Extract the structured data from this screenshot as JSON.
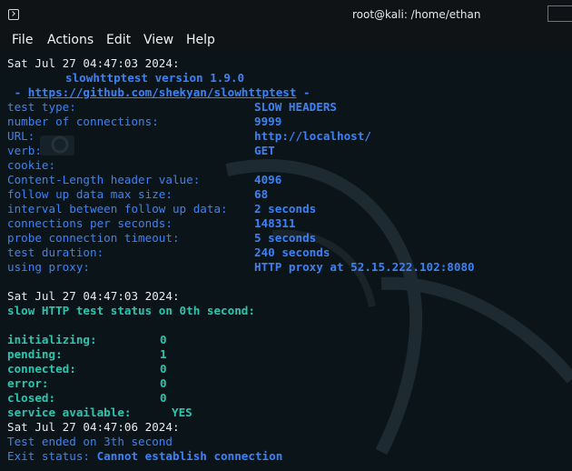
{
  "window": {
    "title": "root@kali: /home/ethan",
    "icon": "terminal-icon"
  },
  "menu": [
    "File",
    "Actions",
    "Edit",
    "View",
    "Help"
  ],
  "terminal": {
    "date1": "Sat Jul 27 04:47:03 2024:",
    "version": "slowhttptest version 1.9.0",
    "url_prefix": " - ",
    "url": "https://github.com/shekyan/slowhttptest",
    "url_suffix": " -",
    "params": [
      {
        "key": "test type:",
        "value": "SLOW HEADERS"
      },
      {
        "key": "number of connections:",
        "value": "9999"
      },
      {
        "key": "URL:",
        "value": "http://localhost/"
      },
      {
        "key": "verb:",
        "value": "GET"
      },
      {
        "key": "cookie:",
        "value": ""
      },
      {
        "key": "Content-Length header value:",
        "value": "4096"
      },
      {
        "key": "follow up data max size:",
        "value": "68"
      },
      {
        "key": "interval between follow up data:",
        "value": "2 seconds"
      },
      {
        "key": "connections per seconds:",
        "value": "148311"
      },
      {
        "key": "probe connection timeout:",
        "value": "5 seconds"
      },
      {
        "key": "test duration:",
        "value": "240 seconds"
      },
      {
        "key": "using proxy:",
        "value": "HTTP proxy at 52.15.222.102:8080"
      }
    ],
    "date2": "Sat Jul 27 04:47:03 2024:",
    "status_line": "slow HTTP test status on 0th second:",
    "status": [
      {
        "key": "initializing:",
        "value": "0"
      },
      {
        "key": "pending:",
        "value": "1"
      },
      {
        "key": "connected:",
        "value": "0"
      },
      {
        "key": "error:",
        "value": "0"
      },
      {
        "key": "closed:",
        "value": "0"
      },
      {
        "key": "service available:",
        "value": "YES"
      }
    ],
    "date3": "Sat Jul 27 04:47:06 2024:",
    "ended": "Test ended on 3th second",
    "exit_label": "Exit status: ",
    "exit_value": "Cannot establish connection"
  }
}
